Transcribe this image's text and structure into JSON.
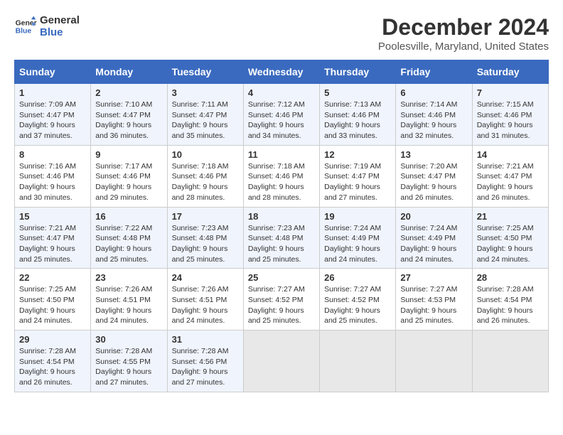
{
  "header": {
    "logo_line1": "General",
    "logo_line2": "Blue",
    "month_title": "December 2024",
    "location": "Poolesville, Maryland, United States"
  },
  "days_of_week": [
    "Sunday",
    "Monday",
    "Tuesday",
    "Wednesday",
    "Thursday",
    "Friday",
    "Saturday"
  ],
  "weeks": [
    [
      {
        "day": "1",
        "sunrise": "7:09 AM",
        "sunset": "4:47 PM",
        "daylight": "9 hours and 37 minutes."
      },
      {
        "day": "2",
        "sunrise": "7:10 AM",
        "sunset": "4:47 PM",
        "daylight": "9 hours and 36 minutes."
      },
      {
        "day": "3",
        "sunrise": "7:11 AM",
        "sunset": "4:47 PM",
        "daylight": "9 hours and 35 minutes."
      },
      {
        "day": "4",
        "sunrise": "7:12 AM",
        "sunset": "4:46 PM",
        "daylight": "9 hours and 34 minutes."
      },
      {
        "day": "5",
        "sunrise": "7:13 AM",
        "sunset": "4:46 PM",
        "daylight": "9 hours and 33 minutes."
      },
      {
        "day": "6",
        "sunrise": "7:14 AM",
        "sunset": "4:46 PM",
        "daylight": "9 hours and 32 minutes."
      },
      {
        "day": "7",
        "sunrise": "7:15 AM",
        "sunset": "4:46 PM",
        "daylight": "9 hours and 31 minutes."
      }
    ],
    [
      {
        "day": "8",
        "sunrise": "7:16 AM",
        "sunset": "4:46 PM",
        "daylight": "9 hours and 30 minutes."
      },
      {
        "day": "9",
        "sunrise": "7:17 AM",
        "sunset": "4:46 PM",
        "daylight": "9 hours and 29 minutes."
      },
      {
        "day": "10",
        "sunrise": "7:18 AM",
        "sunset": "4:46 PM",
        "daylight": "9 hours and 28 minutes."
      },
      {
        "day": "11",
        "sunrise": "7:18 AM",
        "sunset": "4:46 PM",
        "daylight": "9 hours and 28 minutes."
      },
      {
        "day": "12",
        "sunrise": "7:19 AM",
        "sunset": "4:47 PM",
        "daylight": "9 hours and 27 minutes."
      },
      {
        "day": "13",
        "sunrise": "7:20 AM",
        "sunset": "4:47 PM",
        "daylight": "9 hours and 26 minutes."
      },
      {
        "day": "14",
        "sunrise": "7:21 AM",
        "sunset": "4:47 PM",
        "daylight": "9 hours and 26 minutes."
      }
    ],
    [
      {
        "day": "15",
        "sunrise": "7:21 AM",
        "sunset": "4:47 PM",
        "daylight": "9 hours and 25 minutes."
      },
      {
        "day": "16",
        "sunrise": "7:22 AM",
        "sunset": "4:48 PM",
        "daylight": "9 hours and 25 minutes."
      },
      {
        "day": "17",
        "sunrise": "7:23 AM",
        "sunset": "4:48 PM",
        "daylight": "9 hours and 25 minutes."
      },
      {
        "day": "18",
        "sunrise": "7:23 AM",
        "sunset": "4:48 PM",
        "daylight": "9 hours and 25 minutes."
      },
      {
        "day": "19",
        "sunrise": "7:24 AM",
        "sunset": "4:49 PM",
        "daylight": "9 hours and 24 minutes."
      },
      {
        "day": "20",
        "sunrise": "7:24 AM",
        "sunset": "4:49 PM",
        "daylight": "9 hours and 24 minutes."
      },
      {
        "day": "21",
        "sunrise": "7:25 AM",
        "sunset": "4:50 PM",
        "daylight": "9 hours and 24 minutes."
      }
    ],
    [
      {
        "day": "22",
        "sunrise": "7:25 AM",
        "sunset": "4:50 PM",
        "daylight": "9 hours and 24 minutes."
      },
      {
        "day": "23",
        "sunrise": "7:26 AM",
        "sunset": "4:51 PM",
        "daylight": "9 hours and 24 minutes."
      },
      {
        "day": "24",
        "sunrise": "7:26 AM",
        "sunset": "4:51 PM",
        "daylight": "9 hours and 24 minutes."
      },
      {
        "day": "25",
        "sunrise": "7:27 AM",
        "sunset": "4:52 PM",
        "daylight": "9 hours and 25 minutes."
      },
      {
        "day": "26",
        "sunrise": "7:27 AM",
        "sunset": "4:52 PM",
        "daylight": "9 hours and 25 minutes."
      },
      {
        "day": "27",
        "sunrise": "7:27 AM",
        "sunset": "4:53 PM",
        "daylight": "9 hours and 25 minutes."
      },
      {
        "day": "28",
        "sunrise": "7:28 AM",
        "sunset": "4:54 PM",
        "daylight": "9 hours and 26 minutes."
      }
    ],
    [
      {
        "day": "29",
        "sunrise": "7:28 AM",
        "sunset": "4:54 PM",
        "daylight": "9 hours and 26 minutes."
      },
      {
        "day": "30",
        "sunrise": "7:28 AM",
        "sunset": "4:55 PM",
        "daylight": "9 hours and 27 minutes."
      },
      {
        "day": "31",
        "sunrise": "7:28 AM",
        "sunset": "4:56 PM",
        "daylight": "9 hours and 27 minutes."
      },
      null,
      null,
      null,
      null
    ]
  ],
  "labels": {
    "sunrise": "Sunrise:",
    "sunset": "Sunset:",
    "daylight": "Daylight:"
  }
}
